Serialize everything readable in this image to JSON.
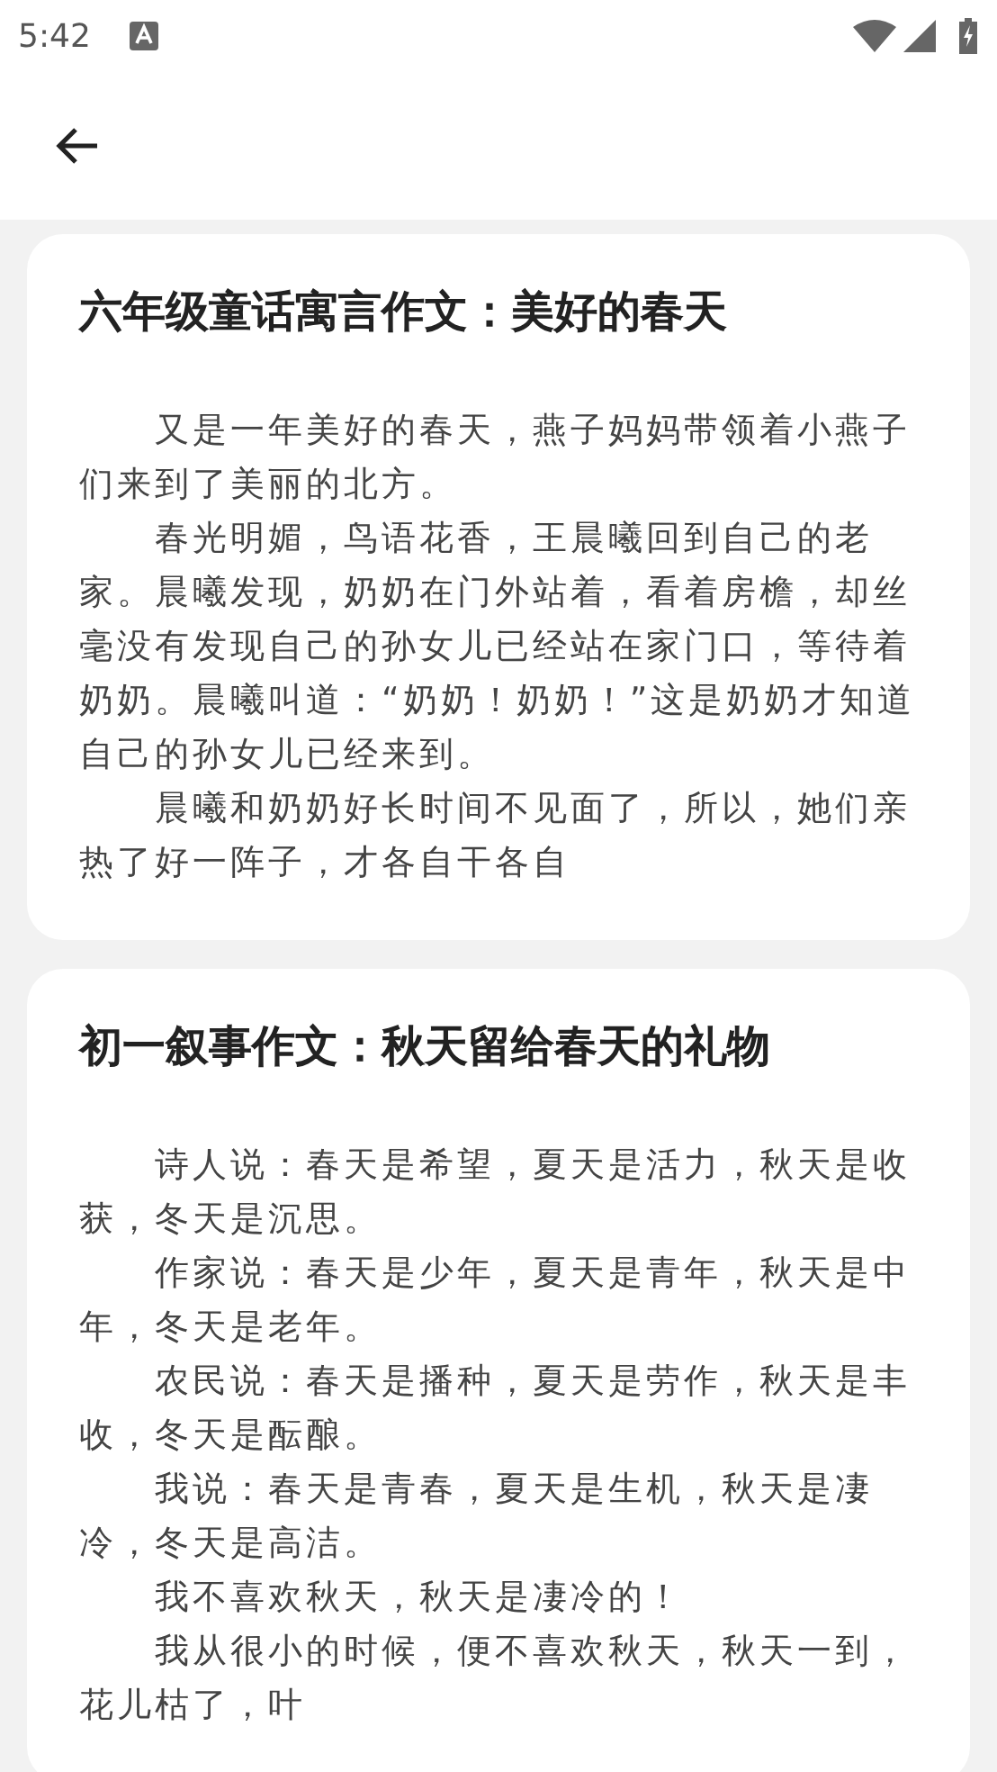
{
  "status_bar": {
    "time": "5:42"
  },
  "articles": [
    {
      "title": "六年级童话寓言作文：美好的春天",
      "paragraphs": [
        "又是一年美好的春天，燕子妈妈带领着小燕子们来到了美丽的北方。",
        "春光明媚，鸟语花香，王晨曦回到自己的老家。晨曦发现，奶奶在门外站着，看着房檐，却丝毫没有发现自己的孙女儿已经站在家门口，等待着奶奶。晨曦叫道：“奶奶！奶奶！”这是奶奶才知道自己的孙女儿已经来到。",
        "晨曦和奶奶好长时间不见面了，所以，她们亲热了好一阵子，才各自干各自"
      ]
    },
    {
      "title": "初一叙事作文：秋天留给春天的礼物",
      "paragraphs": [
        "诗人说：春天是希望，夏天是活力，秋天是收获，冬天是沉思。",
        "作家说：春天是少年，夏天是青年，秋天是中年，冬天是老年。",
        "农民说：春天是播种，夏天是劳作，秋天是丰收，冬天是酝酿。",
        "我说：春天是青春，夏天是生机，秋天是凄冷，冬天是高洁。",
        "我不喜欢秋天，秋天是凄冷的！",
        "我从很小的时候，便不喜欢秋天，秋天一到，花儿枯了，叶"
      ]
    }
  ]
}
